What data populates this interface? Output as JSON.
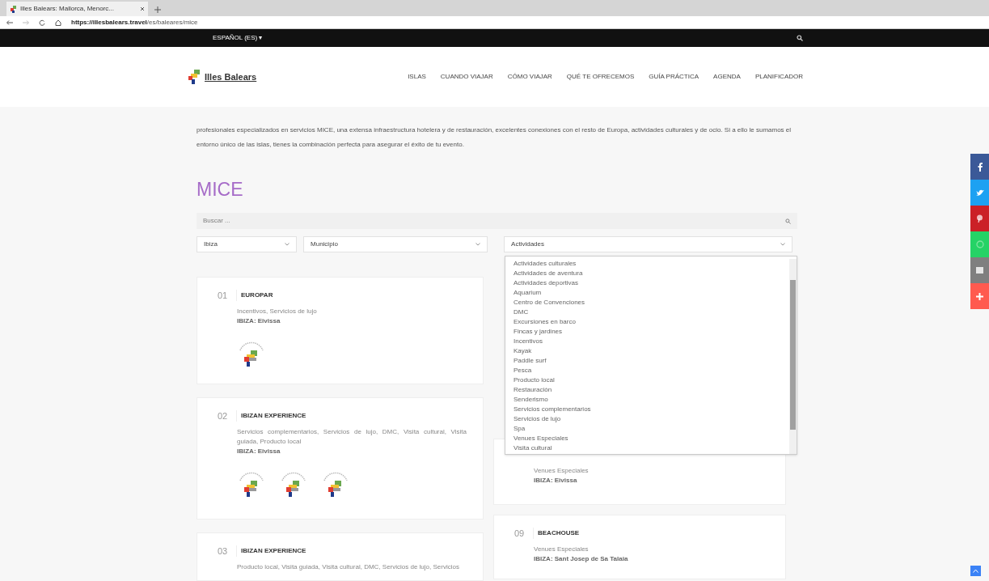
{
  "browser": {
    "tab_title": "Illes Balears: Mallorca, Menorc...",
    "url_host": "https://illesbalears.travel",
    "url_path": "/es/baleares/mice"
  },
  "top_bar": {
    "language": "ESPAÑOL (ES) ▾"
  },
  "header": {
    "logo": "Illes Balears",
    "nav": [
      "ISLAS",
      "CUANDO VIAJAR",
      "CÓMO VIAJAR",
      "QUÉ TE OFRECEMOS",
      "GUÍA PRÁCTICA",
      "AGENDA",
      "PLANIFICADOR"
    ]
  },
  "intro": "profesionales especializados en servicios MICE, una extensa infraestructura hotelera y de restauración, excelentes conexiones con el resto de Europa, actividades culturales y de ocio. Si a ello le sumamos el entorno único de las islas, tienes la combinación perfecta para asegurar el éxito de tu evento.",
  "title": "MICE",
  "search": {
    "placeholder": "Buscar ..."
  },
  "filters": [
    {
      "value": "Ibiza"
    },
    {
      "value": "Municipio"
    },
    {
      "value": "Actividades",
      "open": true
    }
  ],
  "dropdown_options": [
    "Actividades culturales",
    "Actividades de aventura",
    "Actividades deportivas",
    "Aquarium",
    "Centro de Convenciones",
    "DMC",
    "Excursiones en barco",
    "Fincas y jardines",
    "Incentivos",
    "Kayak",
    "Paddle surf",
    "Pesca",
    "Producto local",
    "Restauración",
    "Senderismo",
    "Servicios complementarios",
    "Servicios de lujo",
    "Spa",
    "Venues Especiales",
    "Visita cultural"
  ],
  "left_cards": [
    {
      "number": "01",
      "name": "EUROPAR",
      "tags": "Incentivos, Servicios de lujo",
      "location": "IBIZA: Eivissa"
    },
    {
      "number": "02",
      "name": "IBIZAN EXPERIENCE",
      "tags": "Servicios complementarios, Servicios de lujo, DMC, Visita cultural, Visita guiada, Producto local",
      "location": "IBIZA: Eivissa"
    },
    {
      "number": "03",
      "name": "IBIZAN EXPERIENCE",
      "tags": "Producto local, Visita guiada, Visita cultural, DMC, Servicios de lujo, Servicios"
    }
  ],
  "right_cards": [
    {
      "tags": "Venues Especiales",
      "location": "IBIZA: Eivissa"
    },
    {
      "number": "09",
      "name": "BEACHOUSE",
      "tags": "Venues Especiales",
      "location": "IBIZA: Sant Josep de Sa Talaia"
    }
  ],
  "share_buttons": [
    {
      "kind": "facebook",
      "color": "#3b5998"
    },
    {
      "kind": "twitter",
      "color": "#1da1f2"
    },
    {
      "kind": "pinterest",
      "color": "#cb2027"
    },
    {
      "kind": "whatsapp",
      "color": "#25d366"
    },
    {
      "kind": "email",
      "color": "#7f7f7f"
    },
    {
      "kind": "more",
      "color": "#ff5a4f"
    }
  ]
}
